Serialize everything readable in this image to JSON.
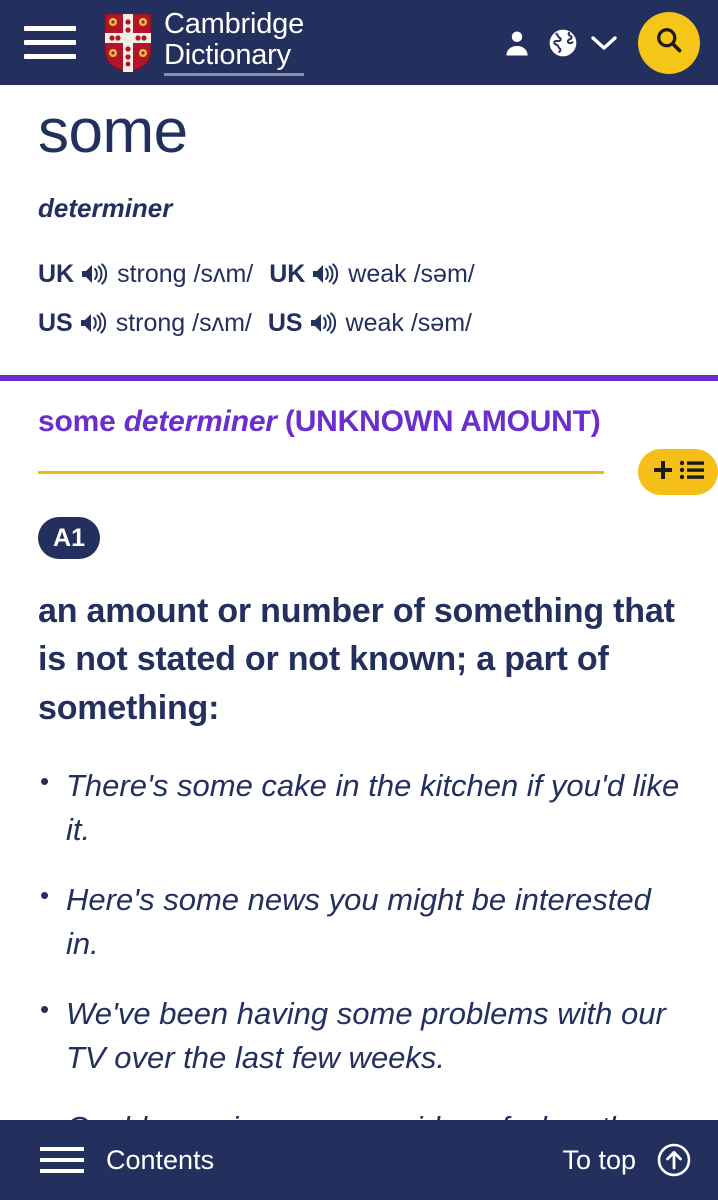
{
  "header": {
    "menu_icon": "hamburger-menu-icon",
    "brand_line1": "Cambridge",
    "brand_line2": "Dictionary",
    "crest_icon": "cambridge-crest-icon",
    "account_icon": "person-icon",
    "language_icon": "globe-icon",
    "language_chevron_icon": "chevron-down-icon",
    "search_icon": "search-icon"
  },
  "entry": {
    "headword": "some",
    "part_of_speech": "determiner",
    "pronunciations": [
      {
        "region": "UK",
        "speaker_icon": "speaker-icon",
        "strength": "strong",
        "ipa": "/sʌm/"
      },
      {
        "region": "UK",
        "speaker_icon": "speaker-icon",
        "strength": "weak",
        "ipa": "/səm/"
      },
      {
        "region": "US",
        "speaker_icon": "speaker-icon",
        "strength": "strong",
        "ipa": "/sʌm/"
      },
      {
        "region": "US",
        "speaker_icon": "speaker-icon",
        "strength": "weak",
        "ipa": "/səm/"
      }
    ]
  },
  "sense": {
    "head_word": "some",
    "head_pos": "determiner",
    "head_guideword": "(UNKNOWN AMOUNT)",
    "add_to_wordlist_icons": [
      "plus-icon",
      "list-icon"
    ],
    "level": "A1",
    "definition": "an amount or number of something that is not stated or not known; a part of something:",
    "examples": [
      "There's some cake in the kitchen if you'd like it.",
      "Here's some news you might be interested in.",
      "We've been having some problems with our TV over the last few weeks.",
      "Could you give me some idea of when the construction work will finish?"
    ]
  },
  "bottom_bar": {
    "contents_icon": "hamburger-menu-icon",
    "contents_label": "Contents",
    "to_top_label": "To top",
    "to_top_icon": "arrow-up-circle-icon"
  },
  "colors": {
    "navy": "#23305e",
    "purple": "#6a2ecf",
    "yellow": "#f5c518",
    "yellow_rule": "#f0b90b",
    "white": "#ffffff"
  }
}
